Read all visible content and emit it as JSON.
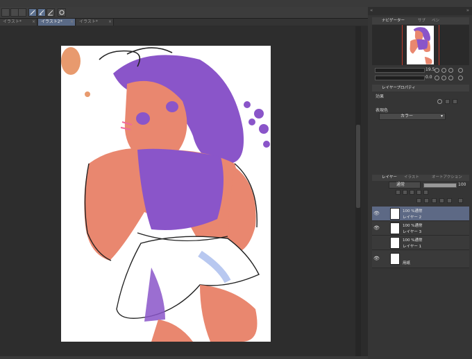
{
  "tabs": [
    {
      "label": "イラスト*",
      "close": "×"
    },
    {
      "label": "イラスト2*",
      "close": "×"
    },
    {
      "label": "イラスト*",
      "close": "×"
    }
  ],
  "right_panel": {
    "navigator_tab": "ナビゲーター",
    "tab2": "サブ",
    "tab3": "ペン",
    "zoom_value": "19.5",
    "rotate_value": "0.0",
    "property_tab": "レイヤープロパティ",
    "effect_label": "効果",
    "expression_color_label": "表現色",
    "expression_color_value": "カラー",
    "layer_tab": "レイヤー",
    "layer_tab2": "イラスト",
    "layer_tab3": "オートアクション",
    "blend_mode": "通常",
    "opacity": "100"
  },
  "layers": [
    {
      "mode": "100 %通常",
      "name": "レイヤー 2",
      "selected": true,
      "visible": true
    },
    {
      "mode": "100 %通常",
      "name": "レイヤー 3",
      "selected": false,
      "visible": true
    },
    {
      "mode": "100 %通常",
      "name": "レイヤー 1",
      "selected": false,
      "visible": false
    },
    {
      "mode": "",
      "name": "用紙",
      "selected": false,
      "visible": true
    }
  ],
  "colors": {
    "accent": "#5d6985",
    "purple": "#8a55c9",
    "skin": "#e9876f",
    "paper": "#ffffff"
  }
}
